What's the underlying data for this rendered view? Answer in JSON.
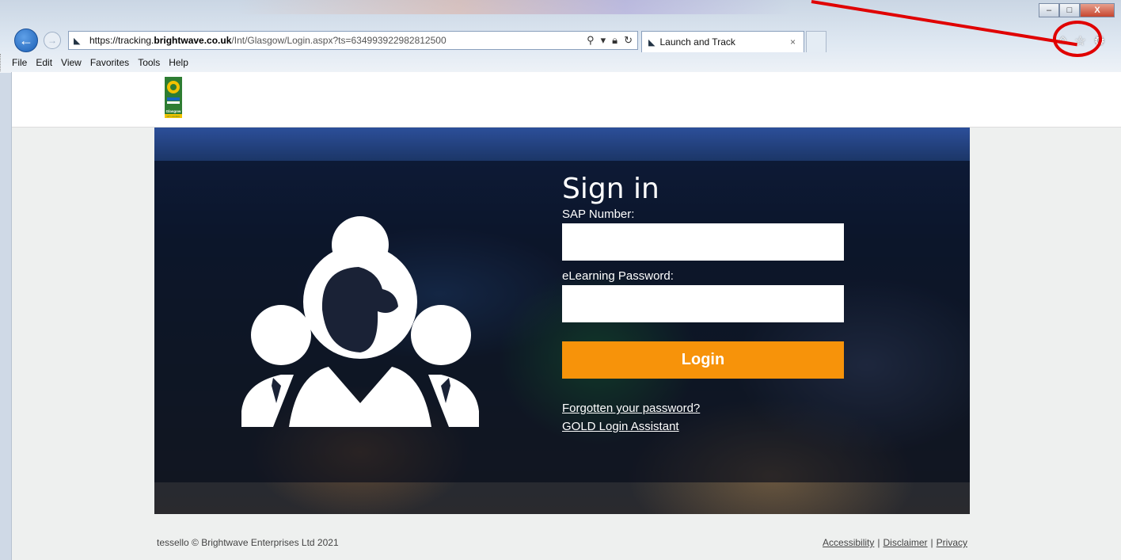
{
  "browser": {
    "url": {
      "protocol": "https://tracking.",
      "domain": "brightwave.co.uk",
      "path": "/Int/Glasgow/Login.aspx?ts=634993922982812500"
    },
    "tab_title": "Launch and Track",
    "tab_close": "×",
    "menu": [
      "File",
      "Edit",
      "View",
      "Favorites",
      "Tools",
      "Help"
    ],
    "window_controls": {
      "minimize": "–",
      "maximize": "□",
      "close": "X"
    },
    "toolbar_icons": [
      "home-icon",
      "favorites-star-icon",
      "settings-gear-icon"
    ],
    "annotation_color": "#e00000"
  },
  "header": {
    "logo_text": "Glasgow",
    "logo_subtext": "CITY COUNCIL"
  },
  "signin": {
    "title": "Sign in",
    "sap_label": "SAP Number:",
    "password_label": "eLearning Password:",
    "login_button": "Login",
    "forgot_link": "Forgotten your password?",
    "assistant_link": "GOLD Login Assistant",
    "accent_color": "#f7930a"
  },
  "footer": {
    "copyright": "tessello © Brightwave Enterprises Ltd 2021",
    "links": {
      "accessibility": "Accessibility",
      "disclaimer": "Disclaimer",
      "privacy": "Privacy"
    },
    "separator": "|"
  }
}
